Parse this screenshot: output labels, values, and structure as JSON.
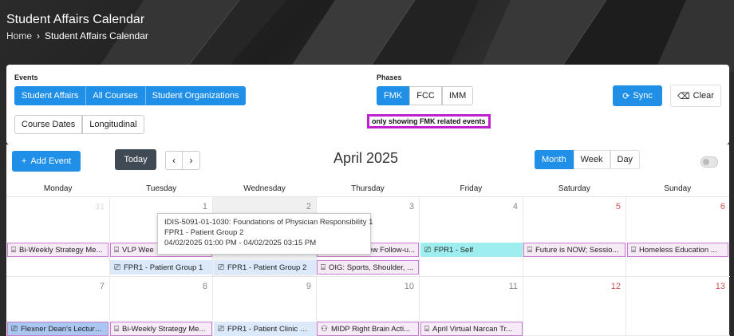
{
  "page": {
    "title": "Student Affairs Calendar",
    "breadcrumb": {
      "home": "Home",
      "separator": "›",
      "current": "Student Affairs Calendar"
    }
  },
  "filters": {
    "events_label": "Events",
    "events_buttons": [
      "Student Affairs",
      "All Courses",
      "Student Organizations"
    ],
    "course_buttons": [
      "Course Dates",
      "Longitudinal"
    ],
    "phases_label": "Phases",
    "phases_buttons": [
      "FMK",
      "FCC",
      "IMM"
    ],
    "active_phase": "FMK",
    "notice": "only showing FMK related events",
    "sync_label": "Sync",
    "clear_label": "Clear"
  },
  "calendar": {
    "add_event": "Add Event",
    "today": "Today",
    "prev": "‹",
    "next": "›",
    "month_title": "April 2025",
    "views": [
      "Month",
      "Week",
      "Day"
    ],
    "active_view": "Month",
    "weekdays": [
      "Monday",
      "Tuesday",
      "Wednesday",
      "Thursday",
      "Friday",
      "Saturday",
      "Sunday"
    ],
    "week1_days": [
      "31",
      "1",
      "2",
      "3",
      "4",
      "5",
      "6"
    ],
    "week2_days": [
      "7",
      "8",
      "9",
      "10",
      "11",
      "12",
      "13"
    ],
    "week1_row1": [
      {
        "icon": "meeting-icon",
        "text": "Bi-Weekly Strategy Me..."
      },
      {
        "icon": "meeting-icon",
        "text": "VLP Wee"
      },
      {
        "icon": "",
        "text": ""
      },
      {
        "icon": "",
        "text": "ew Follow-u..."
      },
      {
        "icon": "lecture-icon",
        "text": "FPR1 - Self"
      },
      {
        "icon": "meeting-icon",
        "text": "Future is NOW; Sessio..."
      },
      {
        "icon": "meeting-icon",
        "text": "Homeless Education ..."
      }
    ],
    "week1_row2": [
      {
        "icon": "lecture-icon",
        "text": "FPR1 - Patient Group 1"
      },
      {
        "icon": "lecture-icon",
        "text": "FPR1 - Patient Group 2"
      },
      {
        "icon": "meeting-icon",
        "text": "OIG: Sports, Shoulder, ..."
      }
    ],
    "week2_row1": [
      {
        "icon": "lecture-icon",
        "text": "Flexner Dean's Lecture..."
      },
      {
        "icon": "meeting-icon",
        "text": "Bi-Weekly Strategy Me..."
      },
      {
        "icon": "lecture-icon",
        "text": "FPR1 - Patient Clinic G..."
      },
      {
        "icon": "group-icon",
        "text": "MIDP Right Brain Acti..."
      },
      {
        "icon": "meeting-icon",
        "text": "April Virtual Narcan Tr..."
      }
    ],
    "tooltip": {
      "line1": "IDIS-5091-01-1030: Foundations of Physician Responsibility 1",
      "line2": "FPR1 - Patient Group 2",
      "line3": "04/02/2025 01:00 PM - 04/02/2025 03:15 PM"
    }
  },
  "colors": {
    "primary": "#1f8fe8",
    "dark_button": "#3f4a55",
    "notice_border": "#c020d0",
    "weekend": "#d05050"
  }
}
